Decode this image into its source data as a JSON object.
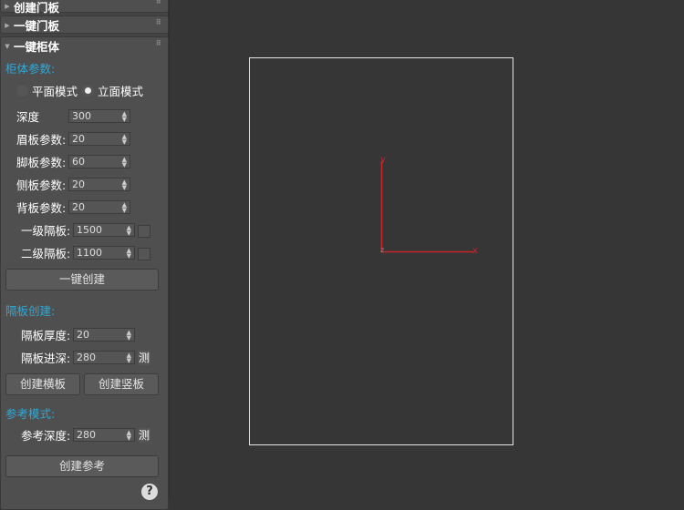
{
  "rollouts": [
    {
      "title": "创建门板",
      "state": "collapsed"
    },
    {
      "title": "一键门板",
      "state": "collapsed"
    },
    {
      "title": "一键柜体",
      "state": "expanded"
    }
  ],
  "cabinet": {
    "section": "柜体参数:",
    "modes": [
      {
        "label": "平面模式",
        "selected": false
      },
      {
        "label": "立面模式",
        "selected": true
      }
    ],
    "fields": [
      {
        "label": "深度",
        "value": "300"
      },
      {
        "label": "眉板参数:",
        "value": "20"
      },
      {
        "label": "脚板参数:",
        "value": "60"
      },
      {
        "label": "侧板参数:",
        "value": "20"
      },
      {
        "label": "背板参数:",
        "value": "20"
      },
      {
        "label": "一级隔板:",
        "value": "1500"
      },
      {
        "label": "二级隔板:",
        "value": "1100"
      }
    ],
    "create_button": "一键创建"
  },
  "partition": {
    "section": "隔板创建:",
    "thickness_label": "隔板厚度:",
    "thickness": "20",
    "depth_label": "隔板进深:",
    "depth": "280",
    "measure": "测",
    "horizontal_button": "创建横板",
    "vertical_button": "创建竖板"
  },
  "reference": {
    "section": "参考模式:",
    "depth_label": "参考深度:",
    "depth": "280",
    "measure": "测",
    "create_button": "创建参考"
  },
  "help": "?",
  "axes": {
    "x": "x",
    "y": "y",
    "z": "z",
    "color": "#c8242a"
  }
}
